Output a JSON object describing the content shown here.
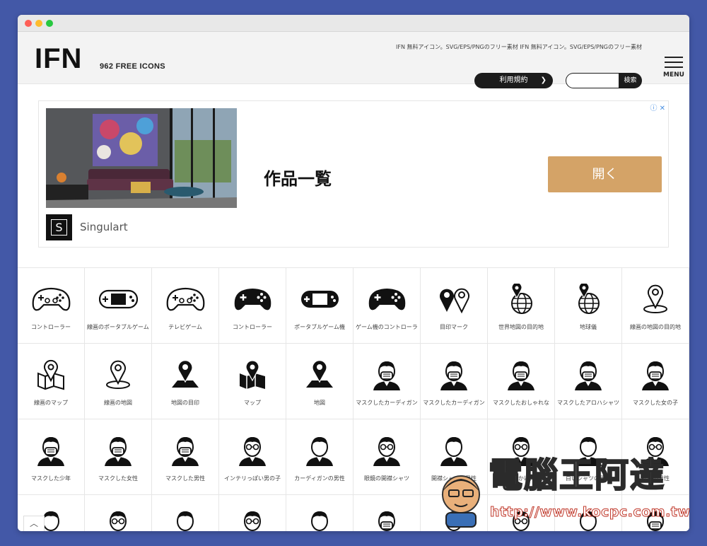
{
  "header": {
    "logo": "IFN",
    "tagline": "962 FREE ICONS",
    "description": "IFN 無料アイコン。SVG/EPS/PNGのフリー素材 IFN 無料アイコン。SVG/EPS/PNGのフリー素材",
    "terms_label": "利用規約",
    "search_placeholder": "",
    "search_button": "検索",
    "menu_label": "MENU"
  },
  "ad": {
    "title": "作品一覧",
    "open_label": "開く",
    "brand": "Singulart",
    "brand_initial": "S",
    "badge": "ⓘ ✕"
  },
  "icons": [
    {
      "label": "コントローラー",
      "icon": "gamepad-outline-icon"
    },
    {
      "label": "線画のポータブルゲーム機",
      "icon": "portable-game-outline-icon"
    },
    {
      "label": "テレビゲーム",
      "icon": "gamepad-outline-icon"
    },
    {
      "label": "コントローラー",
      "icon": "gamepad-solid-icon"
    },
    {
      "label": "ポータブルゲーム機",
      "icon": "portable-game-solid-icon"
    },
    {
      "label": "ゲーム機のコントローラー",
      "icon": "gamepad-solid-icon"
    },
    {
      "label": "目印マーク",
      "icon": "map-pins-icon"
    },
    {
      "label": "世界地図の目的地",
      "icon": "globe-pin-icon"
    },
    {
      "label": "地球儀",
      "icon": "globe-pin-icon"
    },
    {
      "label": "線画の地図の目的地",
      "icon": "pin-ground-outline-icon"
    },
    {
      "label": "線画のマップ",
      "icon": "folded-map-pin-outline-icon"
    },
    {
      "label": "線画の地図",
      "icon": "pin-ground-outline-icon"
    },
    {
      "label": "地図の目印",
      "icon": "pin-ground-solid-icon"
    },
    {
      "label": "マップ",
      "icon": "folded-map-pin-solid-icon"
    },
    {
      "label": "地図",
      "icon": "pin-ground-solid-icon"
    },
    {
      "label": "マスクしたカーディガン",
      "icon": "masked-person-icon"
    },
    {
      "label": "マスクしたカーディガン",
      "icon": "masked-person-icon"
    },
    {
      "label": "マスクしたおしゃれな",
      "icon": "masked-person-icon"
    },
    {
      "label": "マスクしたアロハシャツ",
      "icon": "masked-person-icon"
    },
    {
      "label": "マスクした女の子",
      "icon": "masked-person-icon"
    },
    {
      "label": "マスクした少年",
      "icon": "masked-person-icon"
    },
    {
      "label": "マスクした女性",
      "icon": "masked-person-icon"
    },
    {
      "label": "マスクした男性",
      "icon": "masked-person-icon"
    },
    {
      "label": "インテリっぽい男の子",
      "icon": "glasses-person-icon"
    },
    {
      "label": "カーディガンの男性",
      "icon": "person-icon"
    },
    {
      "label": "眼鏡の開襟シャツ",
      "icon": "glasses-person-icon"
    },
    {
      "label": "開襟シャツの男性",
      "icon": "person-icon"
    },
    {
      "label": "めがねをかけた男性",
      "icon": "glasses-person-icon"
    },
    {
      "label": "白いシャツの男性",
      "icon": "person-icon"
    },
    {
      "label": "眼鏡の男性",
      "icon": "glasses-person-icon"
    },
    {
      "label": "",
      "icon": "person-icon"
    },
    {
      "label": "",
      "icon": "glasses-person-icon"
    },
    {
      "label": "",
      "icon": "person-icon"
    },
    {
      "label": "",
      "icon": "glasses-person-icon"
    },
    {
      "label": "",
      "icon": "person-icon"
    },
    {
      "label": "",
      "icon": "masked-person-icon"
    },
    {
      "label": "",
      "icon": "person-icon"
    },
    {
      "label": "",
      "icon": "glasses-person-icon"
    },
    {
      "label": "",
      "icon": "person-icon"
    },
    {
      "label": "",
      "icon": "masked-person-icon"
    }
  ],
  "watermark": {
    "text": "電腦王阿達",
    "url": "http://www.kocpc.com.tw"
  },
  "colors": {
    "background": "#4358a7",
    "ad_button": "#d4a367",
    "dark_button": "#1c1c1c"
  }
}
